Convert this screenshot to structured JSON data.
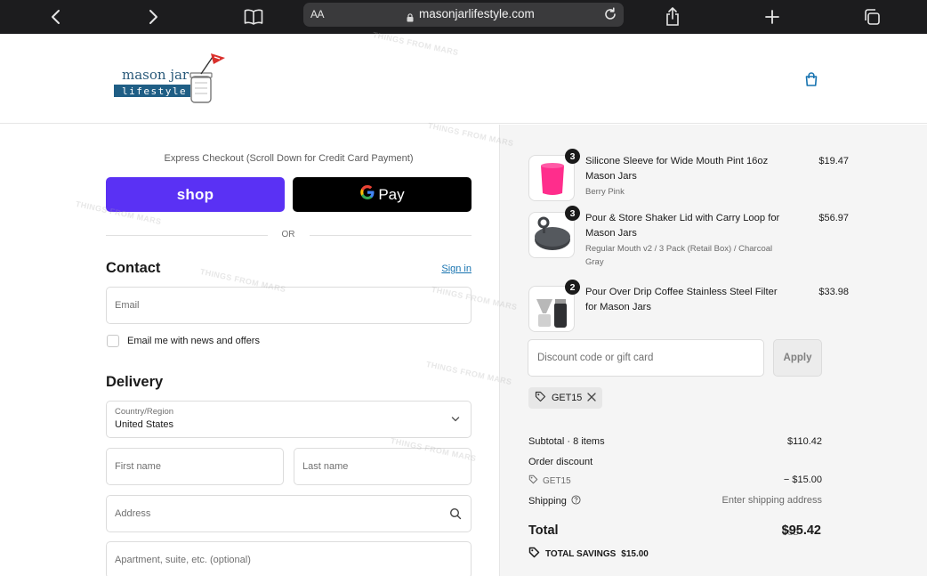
{
  "browser": {
    "aa_label": "AA",
    "url": "masonjarlifestyle.com",
    "back_icon": "chevron-left-icon",
    "forward_icon": "chevron-right-icon",
    "bookmarks_icon": "book-icon",
    "share_icon": "share-icon",
    "new_tab_icon": "plus-icon",
    "tabs_icon": "tabs-icon",
    "dark_bg": "#1c1c1e"
  },
  "header": {
    "logo_line1": "mason jar",
    "logo_line2": "lifestyle",
    "cart_icon": "shopping-bag-icon"
  },
  "express": {
    "title": "Express Checkout (Scroll Down for Credit Card Payment)",
    "shop_label": "shop",
    "gpay_label": "Pay",
    "or_label": "OR",
    "shop_color": "#5a31f4"
  },
  "contact": {
    "heading": "Contact",
    "signin": "Sign in",
    "email_placeholder": "Email",
    "newsletter_label": "Email me with news and offers"
  },
  "delivery": {
    "heading": "Delivery",
    "country_label": "Country/Region",
    "country_value": "United States",
    "first_name_placeholder": "First name",
    "last_name_placeholder": "Last name",
    "address_placeholder": "Address",
    "apartment_placeholder": "Apartment, suite, etc. (optional)"
  },
  "cart": {
    "items": [
      {
        "qty": "3",
        "name": "Silicone Sleeve for Wide Mouth Pint 16oz Mason Jars",
        "variant": "Berry Pink",
        "price": "$19.47",
        "thumb_color": "#ff2d8c"
      },
      {
        "qty": "3",
        "name": "Pour & Store Shaker Lid with Carry Loop for Mason Jars",
        "variant": "Regular Mouth v2 / 3 Pack (Retail Box) / Charcoal Gray",
        "price": "$56.97",
        "thumb_color": "#4a4d52"
      },
      {
        "qty": "2",
        "name": "Pour Over Drip Coffee Stainless Steel Filter for Mason Jars",
        "variant": "",
        "price": "$33.98",
        "thumb_color": "#8a8a8a"
      }
    ],
    "discount_placeholder": "Discount code or gift card",
    "apply_label": "Apply",
    "applied_code": "GET15",
    "subtotal_label": "Subtotal · 8 items",
    "subtotal_value": "$110.42",
    "order_discount_label": "Order discount",
    "discount_code": "GET15",
    "discount_value": "− $15.00",
    "shipping_label": "Shipping",
    "shipping_value": "Enter shipping address",
    "total_label": "Total",
    "currency": "USD",
    "total_value": "$95.42",
    "savings_label": "TOTAL SAVINGS",
    "savings_value": "$15.00"
  },
  "watermark": "THINGS FROM MARS"
}
